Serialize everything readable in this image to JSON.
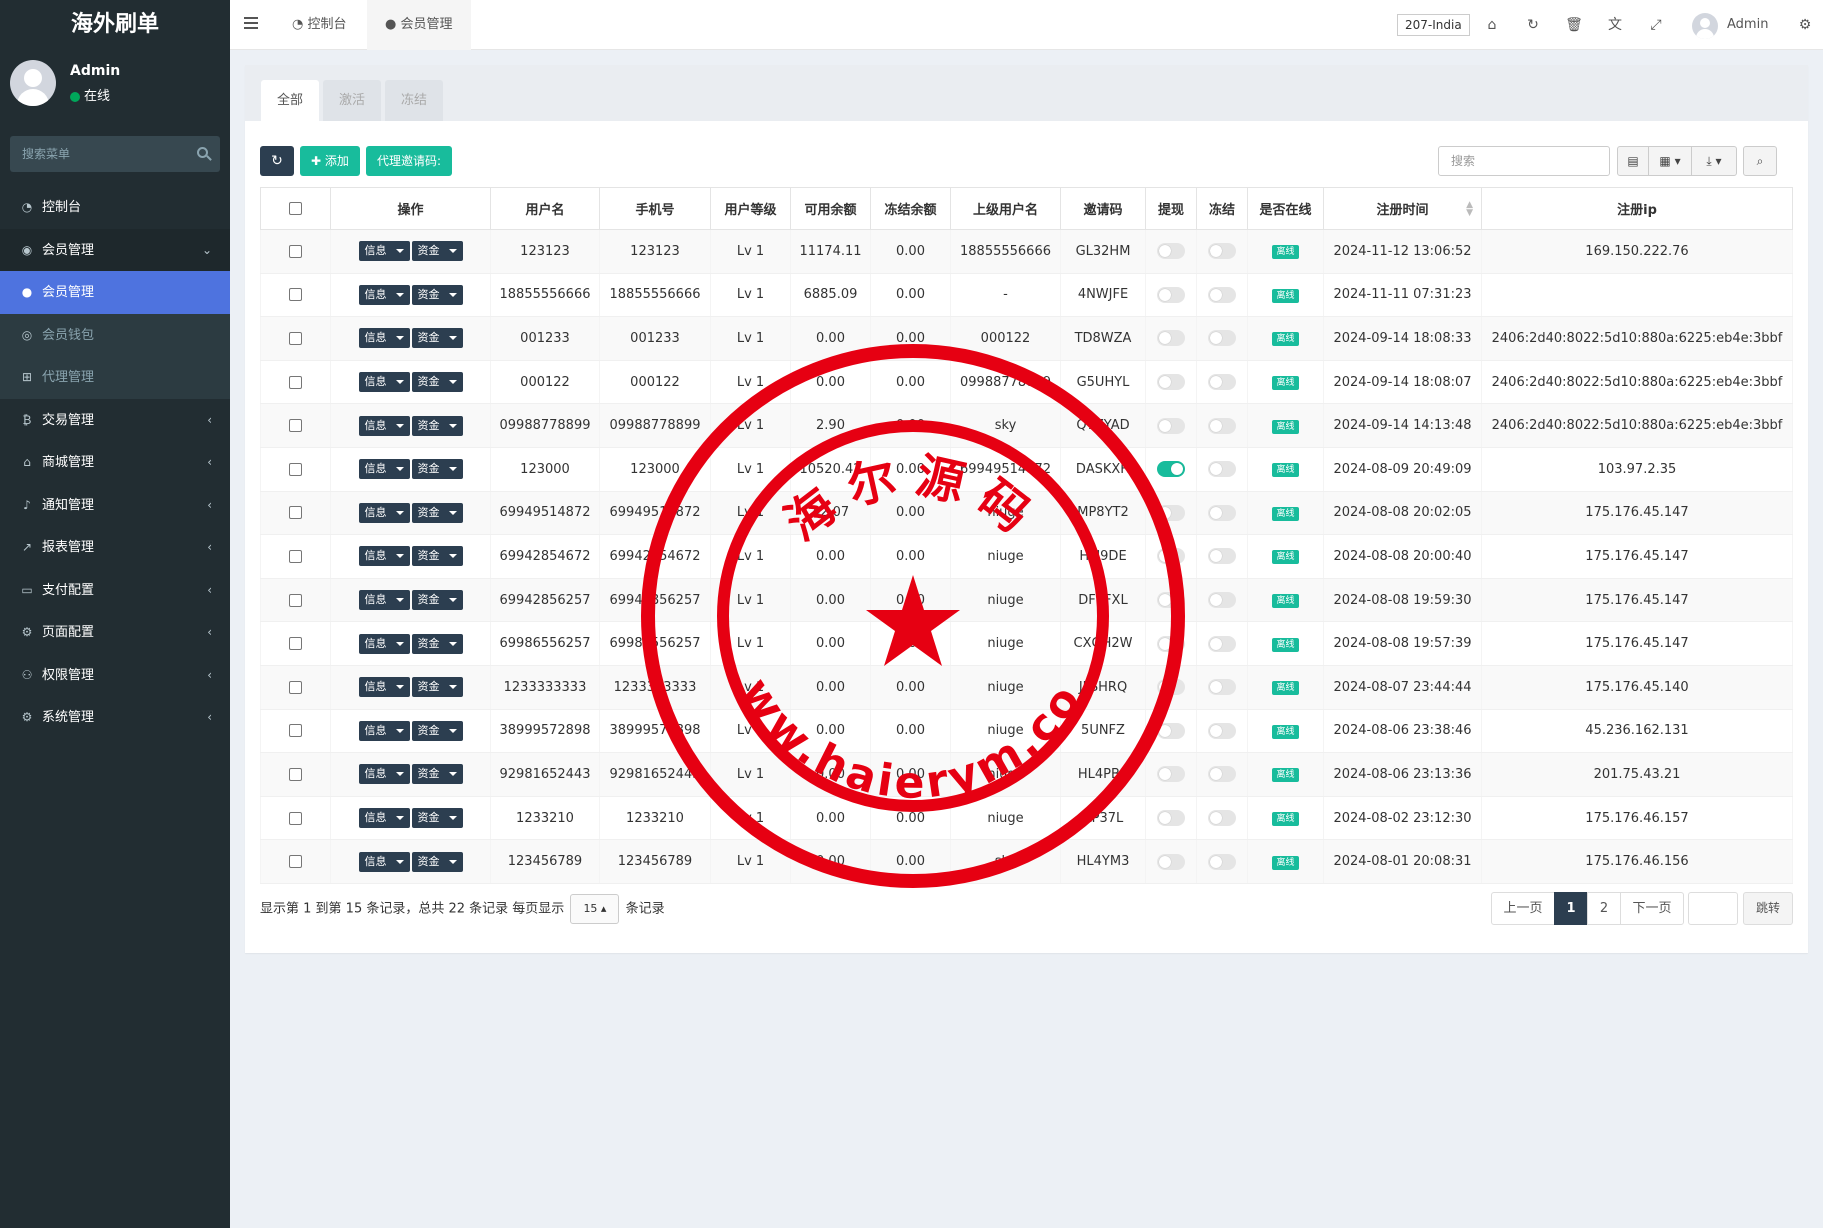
{
  "sidebar": {
    "logo": "海外刷单",
    "user": {
      "name": "Admin",
      "status": "在线"
    },
    "search_placeholder": "搜索菜单",
    "items": [
      {
        "label": "控制台",
        "icon": "dashboard-icon"
      },
      {
        "label": "会员管理",
        "icon": "user-circle-icon",
        "open": true
      },
      {
        "label": "会员管理",
        "icon": "user-icon",
        "active": true,
        "sub": true
      },
      {
        "label": "会员钱包",
        "icon": "wallet-icon",
        "sub": true
      },
      {
        "label": "代理管理",
        "icon": "sitemap-icon",
        "sub": true
      },
      {
        "label": "交易管理",
        "icon": "bitcoin-icon"
      },
      {
        "label": "商城管理",
        "icon": "home-icon"
      },
      {
        "label": "通知管理",
        "icon": "bell-icon"
      },
      {
        "label": "报表管理",
        "icon": "chart-line-icon"
      },
      {
        "label": "支付配置",
        "icon": "credit-card-icon"
      },
      {
        "label": "页面配置",
        "icon": "cog-icon"
      },
      {
        "label": "权限管理",
        "icon": "users-icon"
      },
      {
        "label": "系统管理",
        "icon": "cogs-icon"
      }
    ]
  },
  "navbar": {
    "tabs": [
      "控制台",
      "会员管理"
    ],
    "region": "207-India",
    "admin": "Admin"
  },
  "content": {
    "tabs": [
      "全部",
      "激活",
      "冻结"
    ],
    "add_label": "添加",
    "invite_label": "代理邀请码:",
    "search_placeholder": "搜索",
    "columns": [
      "操作",
      "用户名",
      "手机号",
      "用户等级",
      "可用余额",
      "冻结余额",
      "上级用户名",
      "邀请码",
      "提现",
      "冻结",
      "是否在线",
      "注册时间",
      "注册ip"
    ],
    "op_info": "信息",
    "op_funds": "资金",
    "online_badge": "离线",
    "rows": [
      {
        "username": "123123",
        "phone": "123123",
        "level": "Lv 1",
        "balance": "11174.11",
        "frozen": "0.00",
        "parent": "18855556666",
        "code": "GL32HM",
        "withdraw": false,
        "freeze": false,
        "time": "2024-11-12 13:06:52",
        "ip": "169.150.222.76"
      },
      {
        "username": "18855556666",
        "phone": "18855556666",
        "level": "Lv 1",
        "balance": "6885.09",
        "frozen": "0.00",
        "parent": "-",
        "code": "4NWJFE",
        "withdraw": false,
        "freeze": false,
        "time": "2024-11-11 07:31:23",
        "ip": ""
      },
      {
        "username": "001233",
        "phone": "001233",
        "level": "Lv 1",
        "balance": "0.00",
        "frozen": "0.00",
        "parent": "000122",
        "code": "TD8WZA",
        "withdraw": false,
        "freeze": false,
        "time": "2024-09-14 18:08:33",
        "ip": "2406:2d40:8022:5d10:880a:6225:eb4e:3bbf"
      },
      {
        "username": "000122",
        "phone": "000122",
        "level": "Lv 1",
        "balance": "0.00",
        "frozen": "0.00",
        "parent": "09988778899",
        "code": "G5UHYL",
        "withdraw": false,
        "freeze": false,
        "time": "2024-09-14 18:08:07",
        "ip": "2406:2d40:8022:5d10:880a:6225:eb4e:3bbf"
      },
      {
        "username": "09988778899",
        "phone": "09988778899",
        "level": "Lv 1",
        "balance": "2.90",
        "frozen": "0.00",
        "parent": "sky",
        "code": "Q7ZYAD",
        "withdraw": false,
        "freeze": false,
        "time": "2024-09-14 14:13:48",
        "ip": "2406:2d40:8022:5d10:880a:6225:eb4e:3bbf"
      },
      {
        "username": "123000",
        "phone": "123000",
        "level": "Lv 1",
        "balance": "10520.42",
        "frozen": "0.00",
        "parent": "69949514872",
        "code": "DASKXH",
        "withdraw": true,
        "freeze": false,
        "time": "2024-08-09 20:49:09",
        "ip": "103.97.2.35"
      },
      {
        "username": "69949514872",
        "phone": "69949514872",
        "level": "Lv 1",
        "balance": "42.07",
        "frozen": "0.00",
        "parent": "niuge",
        "code": "MP8YT2",
        "withdraw": false,
        "freeze": false,
        "time": "2024-08-08 20:02:05",
        "ip": "175.176.45.147"
      },
      {
        "username": "69942854672",
        "phone": "69942854672",
        "level": "Lv 1",
        "balance": "0.00",
        "frozen": "0.00",
        "parent": "niuge",
        "code": "HLJ9DE",
        "withdraw": false,
        "freeze": false,
        "time": "2024-08-08 20:00:40",
        "ip": "175.176.45.147"
      },
      {
        "username": "69942856257",
        "phone": "69942856257",
        "level": "Lv 1",
        "balance": "0.00",
        "frozen": "0.00",
        "parent": "niuge",
        "code": "DF7FXL",
        "withdraw": false,
        "freeze": false,
        "time": "2024-08-08 19:59:30",
        "ip": "175.176.45.147"
      },
      {
        "username": "69986556257",
        "phone": "69986556257",
        "level": "Lv 1",
        "balance": "0.00",
        "frozen": "0.00",
        "parent": "niuge",
        "code": "CXGH2W",
        "withdraw": false,
        "freeze": false,
        "time": "2024-08-08 19:57:39",
        "ip": "175.176.45.147"
      },
      {
        "username": "1233333333",
        "phone": "1233333333",
        "level": "Lv 1",
        "balance": "0.00",
        "frozen": "0.00",
        "parent": "niuge",
        "code": "JLSHRQ",
        "withdraw": false,
        "freeze": false,
        "time": "2024-08-07 23:44:44",
        "ip": "175.176.45.140"
      },
      {
        "username": "38999572898",
        "phone": "38999572898",
        "level": "Lv 1",
        "balance": "0.00",
        "frozen": "0.00",
        "parent": "niuge",
        "code": "5UNFZ",
        "withdraw": false,
        "freeze": false,
        "time": "2024-08-06 23:38:46",
        "ip": "45.236.162.131"
      },
      {
        "username": "92981652443",
        "phone": "92981652443",
        "level": "Lv 1",
        "balance": "0.00",
        "frozen": "0.00",
        "parent": "niuge",
        "code": "HL4PB2",
        "withdraw": false,
        "freeze": false,
        "time": "2024-08-06 23:13:36",
        "ip": "201.75.43.21"
      },
      {
        "username": "1233210",
        "phone": "1233210",
        "level": "Lv 1",
        "balance": "0.00",
        "frozen": "0.00",
        "parent": "niuge",
        "code": "AP37L",
        "withdraw": false,
        "freeze": false,
        "time": "2024-08-02 23:12:30",
        "ip": "175.176.46.157"
      },
      {
        "username": "123456789",
        "phone": "123456789",
        "level": "Lv 1",
        "balance": "0.00",
        "frozen": "0.00",
        "parent": "sky",
        "code": "HL4YM3",
        "withdraw": false,
        "freeze": false,
        "time": "2024-08-01 20:08:31",
        "ip": "175.176.46.156"
      }
    ],
    "pagination": {
      "info_prefix": "显示第 1 到第 15 条记录，总共 22 条记录 每页显示",
      "page_size": "15",
      "info_suffix": "条记录",
      "prev": "上一页",
      "pages": [
        "1",
        "2"
      ],
      "current": "1",
      "next": "下一页",
      "jump": "跳转"
    }
  },
  "watermark": {
    "top_text": "海尔源码",
    "bottom_text": "www.haierym.com"
  },
  "colors": {
    "sidebar_bg": "#222d32",
    "accent_blue": "#4e73df",
    "green": "#18bc9c",
    "dark_btn": "#2c3e50",
    "seal_red": "#e60012"
  }
}
